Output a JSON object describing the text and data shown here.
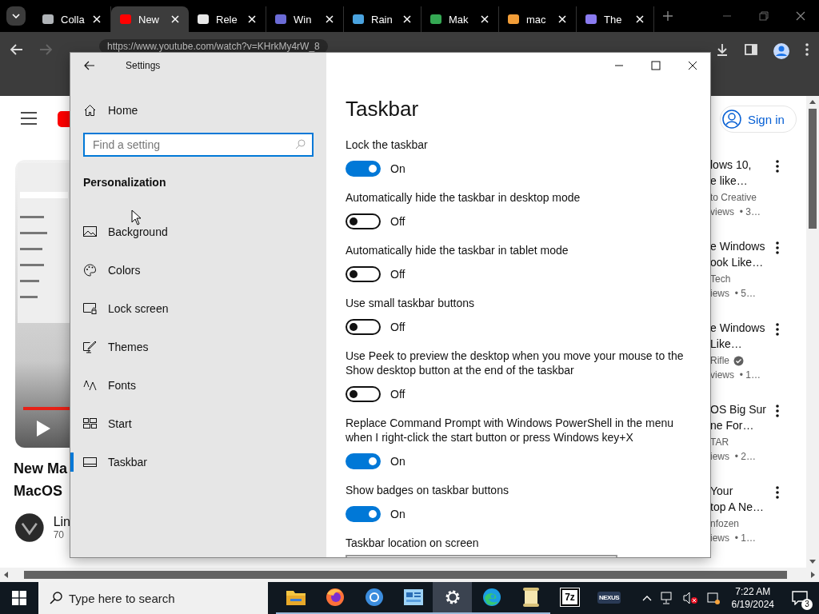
{
  "browser": {
    "tabs": [
      {
        "title": "Colla",
        "selected": false
      },
      {
        "title": "New",
        "selected": true
      },
      {
        "title": "Rele",
        "selected": false
      },
      {
        "title": "Win",
        "selected": false
      },
      {
        "title": "Rain",
        "selected": false
      },
      {
        "title": "Mak",
        "selected": false
      },
      {
        "title": "mac",
        "selected": false
      },
      {
        "title": "The",
        "selected": false
      }
    ],
    "address": "https://www.youtube.com/watch?v=KHrkMy4rW_8"
  },
  "youtube": {
    "sign_in": "Sign in",
    "video_title_lines": [
      "New Ma",
      "MacOS"
    ],
    "channel": "Lin",
    "channel_sub": "70",
    "recommendations": [
      {
        "title_lines": [
          "lows 10,",
          "e like…"
        ],
        "channel": "to Creative",
        "verified": false,
        "meta": "views  • 3…"
      },
      {
        "title_lines": [
          "e Windows",
          "ook Like…"
        ],
        "channel": "Tech",
        "verified": false,
        "meta": "iews  • 5…"
      },
      {
        "title_lines": [
          "e Windows",
          "Like…"
        ],
        "channel": "Rifle",
        "verified": true,
        "meta": "views  • 1…"
      },
      {
        "title_lines": [
          "OS Big Sur",
          "ne For…"
        ],
        "channel": "TAR",
        "verified": false,
        "meta": "iews  • 2…"
      },
      {
        "title_lines": [
          "Your",
          "top A Ne…"
        ],
        "channel": "nfozen",
        "verified": false,
        "meta": "iews  • 1…"
      }
    ]
  },
  "settings": {
    "title": "Settings",
    "home": "Home",
    "search": {
      "placeholder": "Find a setting"
    },
    "section": "Personalization",
    "nav": [
      {
        "label": "Background",
        "selected": false
      },
      {
        "label": "Colors",
        "selected": false
      },
      {
        "label": "Lock screen",
        "selected": false
      },
      {
        "label": "Themes",
        "selected": false
      },
      {
        "label": "Fonts",
        "selected": false
      },
      {
        "label": "Start",
        "selected": false
      },
      {
        "label": "Taskbar",
        "selected": true
      }
    ],
    "page_title": "Taskbar",
    "options": [
      {
        "kind": "toggle",
        "label": "Lock the taskbar",
        "on": true,
        "state_text": "On"
      },
      {
        "kind": "toggle",
        "label": "Automatically hide the taskbar in desktop mode",
        "on": false,
        "state_text": "Off"
      },
      {
        "kind": "toggle",
        "label": "Automatically hide the taskbar in tablet mode",
        "on": false,
        "state_text": "Off"
      },
      {
        "kind": "toggle",
        "label": "Use small taskbar buttons",
        "on": false,
        "state_text": "Off"
      },
      {
        "kind": "toggle",
        "label": "Use Peek to preview the desktop when you move your mouse to the\nShow desktop button at the end of the taskbar",
        "on": false,
        "state_text": "Off"
      },
      {
        "kind": "toggle",
        "label": "Replace Command Prompt with Windows PowerShell in the menu\nwhen I right-click the start button or press Windows key+X",
        "on": true,
        "state_text": "On"
      },
      {
        "kind": "toggle",
        "label": "Show badges on taskbar buttons",
        "on": true,
        "state_text": "On"
      },
      {
        "kind": "dropdown",
        "label": "Taskbar location on screen"
      }
    ]
  },
  "taskbar": {
    "search": {
      "placeholder": "Type here to search"
    },
    "apps": [
      {
        "kind": "folder",
        "running": true,
        "selected": false
      },
      {
        "kind": "firefox",
        "running": true,
        "selected": false
      },
      {
        "kind": "browser",
        "running": true,
        "selected": false
      },
      {
        "kind": "window",
        "running": true,
        "selected": false
      },
      {
        "kind": "settings",
        "running": true,
        "selected": true
      },
      {
        "kind": "edge",
        "running": true,
        "selected": false
      },
      {
        "kind": "notes",
        "running": true,
        "selected": false
      },
      {
        "kind": "archiver",
        "running": false,
        "selected": false,
        "label": "7z"
      },
      {
        "kind": "nexus",
        "running": false,
        "selected": false,
        "label": "NEXUS"
      }
    ],
    "time": "7:22 AM",
    "date": "6/19/2024",
    "notifications": "3"
  }
}
